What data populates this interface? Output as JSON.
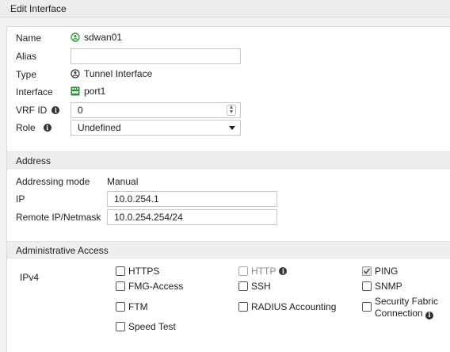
{
  "header": {
    "title": "Edit Interface"
  },
  "general": {
    "name_label": "Name",
    "name_value": "sdwan01",
    "alias_label": "Alias",
    "alias_value": "",
    "type_label": "Type",
    "type_value": "Tunnel Interface",
    "interface_label": "Interface",
    "interface_value": "port1",
    "vrf_label": "VRF ID",
    "vrf_value": "0",
    "role_label": "Role",
    "role_value": "Undefined"
  },
  "address": {
    "section_title": "Address",
    "mode_label": "Addressing mode",
    "mode_value": "Manual",
    "ip_label": "IP",
    "ip_value": "10.0.254.1",
    "remote_label": "Remote IP/Netmask",
    "remote_value": "10.0.254.254/24"
  },
  "admin_access": {
    "section_title": "Administrative Access",
    "ipv4_label": "IPv4",
    "options": [
      {
        "label": "HTTPS",
        "checked": false,
        "disabled": false
      },
      {
        "label": "HTTP",
        "checked": false,
        "disabled": true,
        "info": true
      },
      {
        "label": "PING",
        "checked": true,
        "disabled": false
      },
      {
        "label": "FMG-Access",
        "checked": false,
        "disabled": false
      },
      {
        "label": "SSH",
        "checked": false,
        "disabled": false
      },
      {
        "label": "SNMP",
        "checked": false,
        "disabled": false
      },
      {
        "label": "FTM",
        "checked": false,
        "disabled": false
      },
      {
        "label": "RADIUS Accounting",
        "checked": false,
        "disabled": false
      },
      {
        "label_line1": "Security Fabric",
        "label_line2": "Connection",
        "checked": false,
        "disabled": false,
        "info": true
      },
      {
        "label": "Speed Test",
        "checked": false,
        "disabled": false
      }
    ]
  }
}
